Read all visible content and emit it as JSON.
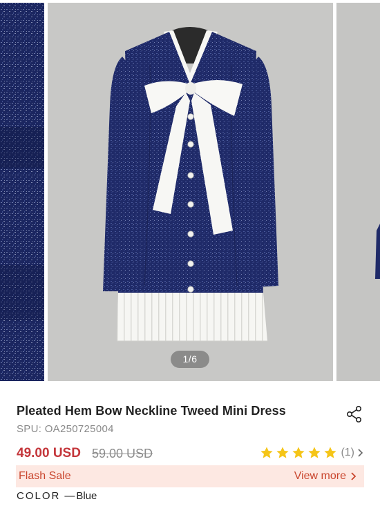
{
  "gallery": {
    "counter": "1/6"
  },
  "product": {
    "title": "Pleated Hem Bow Neckline Tweed Mini Dress",
    "spu_label": "SPU:",
    "spu_value": "OA250725004",
    "price": "49.00 USD",
    "original_price": "59.00 USD",
    "rating_stars": 5,
    "review_count": "(1)",
    "share_icon": "share-icon"
  },
  "flash_sale": {
    "label": "Flash Sale",
    "link": "View more"
  },
  "color": {
    "label": "COLOR",
    "separator": "—",
    "value": "Blue"
  },
  "colors": {
    "price_red": "#c4363b",
    "flash_bg": "#fde8e2",
    "flash_text": "#c9452d",
    "star": "#f5c518",
    "dress_navy": "#1e2864"
  }
}
